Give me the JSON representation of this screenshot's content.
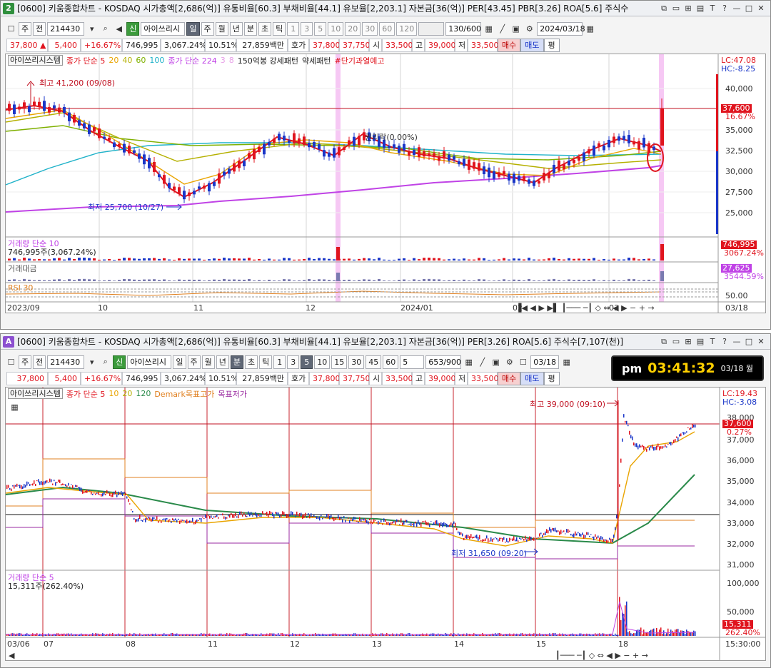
{
  "top": {
    "badge": "2",
    "title": "[0600] 키움종합차트 - KOSDAQ 시가총액[2,686(억)] 유통비율[60.3] 부채비율[44.1] 유보율[2,203.1] 자본금[36(억)] PER[43.45] PBR[3.26] ROA[5.6] 주식수",
    "toolbar": {
      "type_label": "주",
      "prev_label": "전",
      "code": "214430",
      "new_label": "신",
      "indicator_name": "아이쓰리시",
      "periods": [
        "일",
        "주",
        "월",
        "년",
        "분",
        "초",
        "틱"
      ],
      "selected_period": "일",
      "intervals": [
        "1",
        "3",
        "5",
        "10",
        "20",
        "30",
        "60",
        "120"
      ],
      "count": "130/600",
      "date": "2024/03/18"
    },
    "quote": {
      "price": "37,800 ▲",
      "change": "5,400",
      "change_pct": "+16.67%",
      "volume": "746,995",
      "volume_pct": "3,067.24%",
      "turnover": "10.51%",
      "amount": "27,859백만",
      "bid_label": "호가",
      "bid1": "37,800",
      "bid2": "37,750",
      "open_label": "시",
      "open": "33,500",
      "high_label": "고",
      "high": "39,000",
      "low_label": "저",
      "low": "33,500",
      "buy": "매수",
      "sell": "매도",
      "eval": "평"
    },
    "legend": {
      "system": "아이쓰리시스템",
      "ma_label": "종가 단순 5",
      "ma20": "20",
      "ma40": "40",
      "ma60": "60",
      "ma100": "100",
      "ma224_label": "종가 단순 224",
      "extra1": "3",
      "extra2": "8",
      "item1": "150억봉 강세패턴",
      "item2": "약세패턴",
      "item3": "#단기과열예고"
    },
    "annotations": {
      "high": "최고 41,200 (09/08)",
      "low": "최저 25,700 (10/27)",
      "rights": "권리락(0.00%)"
    },
    "yaxis": {
      "lc": "LC:47.08",
      "hc": "HC:-8.25",
      "ticks": [
        "40,000",
        "37,500",
        "35,000",
        "32,500",
        "30,000",
        "27,500",
        "25,000"
      ],
      "price_tag": "37,600",
      "pct_tag": "16.67%"
    },
    "volume_panel": {
      "label": "거래량 단순 10",
      "value": "746,995주(3,067.24%)",
      "tag": "746,995",
      "tag_pct": "3067.24%"
    },
    "amount_panel": {
      "label": "거래대금",
      "tag": "27,625",
      "tag_pct": "3544.59%"
    },
    "rsi_panel": {
      "label": "RSI 30",
      "tick": "50.00"
    },
    "xaxis": [
      "2023/09",
      "10",
      "11",
      "12",
      "2024/01",
      "02",
      "03"
    ],
    "xaxis_right": "03/18"
  },
  "bottom": {
    "badge": "A",
    "title": "[0600] 키움종합차트 - KOSDAQ 시가총액[2,686(억)] 유통비율[60.3] 부채비율[44.1] 유보율[2,203.1] 자본금[36(억)] PER[3.26] ROA[5.6] 주식수[7,107(천)]",
    "toolbar": {
      "type_label": "주",
      "prev_label": "전",
      "code": "214430",
      "new_label": "신",
      "indicator_name": "아이쓰리시",
      "periods": [
        "일",
        "주",
        "월",
        "년",
        "분",
        "초",
        "틱"
      ],
      "selected_period": "분",
      "intervals": [
        "1",
        "3",
        "5",
        "10",
        "15",
        "30",
        "45",
        "60"
      ],
      "interval_select": "5",
      "count": "653/900",
      "date": "03/18"
    },
    "quote": {
      "price": "37,800",
      "change": "5,400",
      "change_pct": "+16.67%",
      "volume": "746,995",
      "volume_pct": "3,067.24%",
      "turnover": "10.51%",
      "amount": "27,859백만",
      "bid_label": "호가",
      "bid1": "37,800",
      "bid2": "37,750",
      "open_label": "시",
      "open": "33,500",
      "high_label": "고",
      "high": "39,000",
      "low_label": "저",
      "low": "33,500",
      "buy": "매수",
      "sell": "매도",
      "eval": "평"
    },
    "clock": {
      "ampm": "pm",
      "time": "03:41:32",
      "date": "03/18 월"
    },
    "legend": {
      "system": "아이쓰리시스템",
      "ma_label": "종가 단순 5",
      "ma10": "10",
      "ma20": "20",
      "ma120": "120",
      "demark_high": "Demark목표고가",
      "demark_low": "목표저가"
    },
    "annotations": {
      "high": "최고 39,000 (09:10)",
      "low": "최저 31,650 (09:20)"
    },
    "yaxis": {
      "lc": "LC:19.43",
      "hc": "HC:-3.08",
      "ticks": [
        "38,000",
        "37,000",
        "36,000",
        "35,000",
        "34,000",
        "33,000",
        "32,000",
        "31,000"
      ],
      "price_tag": "37,600",
      "pct_tag": "0.27%"
    },
    "volume_panel": {
      "label": "거래량 단순 5",
      "value": "15,311주(262.40%)",
      "ticks": [
        "100,000",
        "50,000"
      ],
      "tag": "15,311",
      "tag_pct": "262.40%"
    },
    "xaxis": [
      "03/06",
      "07",
      "08",
      "11",
      "12",
      "13",
      "14",
      "15",
      "18"
    ],
    "xaxis_right": "15:30:00"
  },
  "colors": {
    "up": "#e0141e",
    "down": "#1a36c8",
    "ma5": "#e0141e",
    "ma20": "#e9a400",
    "ma40": "#b5b000",
    "ma60": "#1fb2c9",
    "ma224": "#c043e6",
    "highlight": "#f3b6f0"
  }
}
